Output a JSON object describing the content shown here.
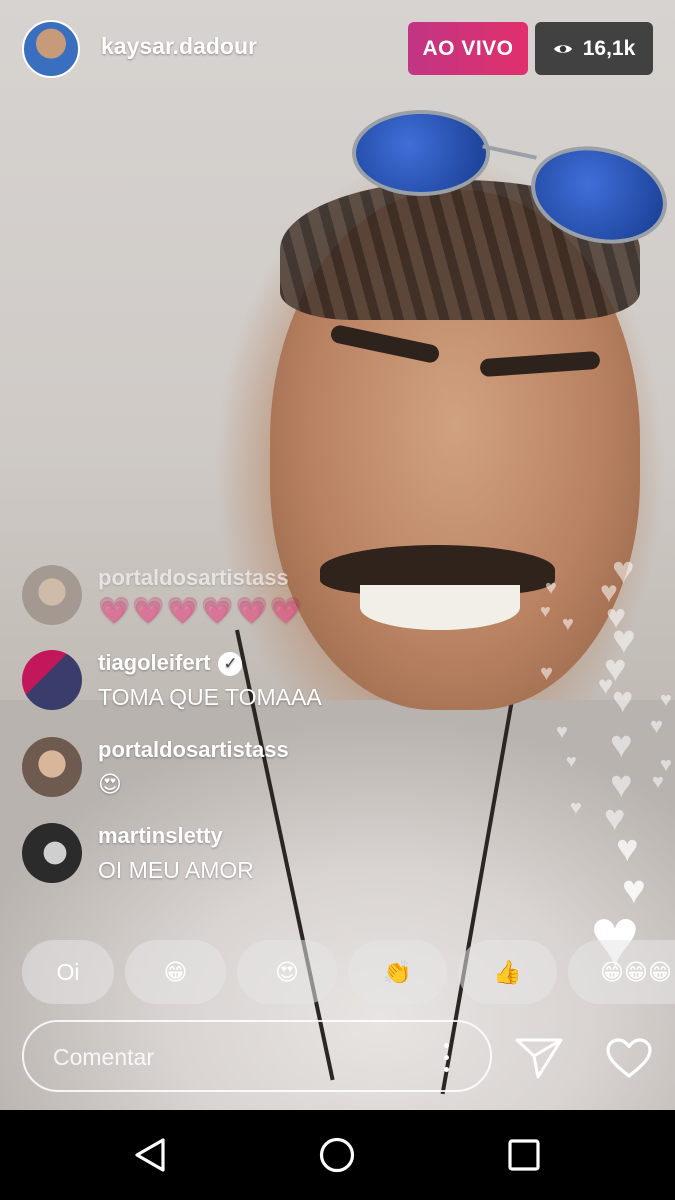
{
  "header": {
    "username": "kaysar.dadour",
    "live_label": "AO VIVO",
    "viewer_count": "16,1k",
    "viewer_icon": "eye-icon"
  },
  "comments": [
    {
      "user": "portaldosartistass",
      "text": "💗💗💗💗💗💗",
      "faded": true
    },
    {
      "user": "tiagoleifert",
      "verified": true,
      "text": "TOMA QUE TOMAAA"
    },
    {
      "user": "portaldosartistass",
      "text": "😍"
    },
    {
      "user": "martinsletty",
      "text": "OI MEU AMOR"
    }
  ],
  "quick_replies": [
    {
      "label": "Oi"
    },
    {
      "label": "😁"
    },
    {
      "label": "😍"
    },
    {
      "label": "👏"
    },
    {
      "label": "👍"
    },
    {
      "label": "😁😁😁"
    }
  ],
  "composer": {
    "placeholder": "Comentar",
    "more_icon": "more-vertical-icon",
    "send_icon": "send-icon",
    "like_icon": "heart-icon"
  },
  "navbar": {
    "back_icon": "back-triangle-icon",
    "home_icon": "home-circle-icon",
    "recents_icon": "recents-square-icon"
  },
  "colors": {
    "live_gradient_start": "#c13584",
    "live_gradient_end": "#e1306c",
    "heart_comment": "#e05a9a"
  }
}
